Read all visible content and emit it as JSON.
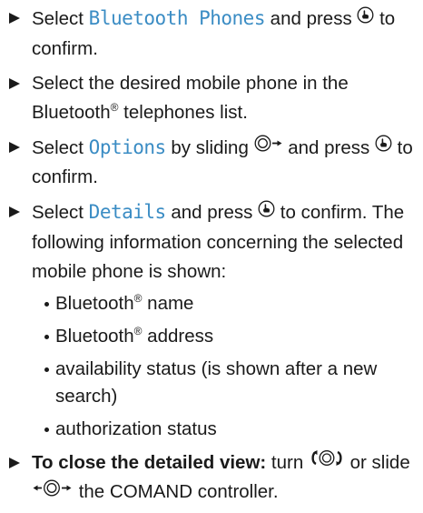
{
  "steps": [
    {
      "pre": "Select ",
      "menu": "Bluetooth Phones",
      "post": " and press ",
      "tail": " to confirm."
    },
    {
      "text": "Select the desired mobile phone in the Bluetooth",
      "reg": "®",
      "tail": " telephones list."
    },
    {
      "pre": "Select ",
      "menu": "Options",
      "mid": " by sliding ",
      "post": " and press ",
      "tail": " to confirm."
    },
    {
      "pre": "Select ",
      "menu": "Details",
      "post": " and press ",
      "tail": " to confirm. The following information concerning the selected mobile phone is shown:",
      "bullets": [
        {
          "text": "Bluetooth",
          "reg": "®",
          "tail": " name"
        },
        {
          "text": "Bluetooth",
          "reg": "®",
          "tail": " address"
        },
        {
          "text": "availability status (is shown after a new search)"
        },
        {
          "text": "authorization status"
        }
      ]
    },
    {
      "bold": "To close the detailed view:",
      "pre": " turn ",
      "mid": " or slide ",
      "tail": " the COMAND controller."
    }
  ],
  "icons": {
    "press": "press-controller-icon",
    "slide_right": "slide-right-controller-icon",
    "turn": "turn-controller-icon",
    "slide_lr": "slide-left-right-controller-icon"
  }
}
